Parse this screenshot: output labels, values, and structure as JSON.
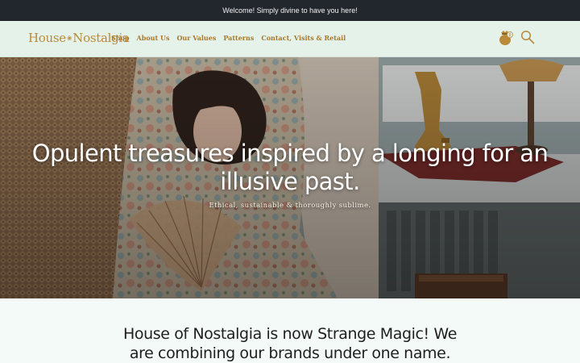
{
  "announcement_bar": {
    "text": "Welcome! Simply divine to have you here!"
  },
  "header": {
    "logo_left": "House",
    "logo_right": "Nostalgia",
    "nav": [
      "Shop",
      "About Us",
      "Our Values",
      "Patterns",
      "Contact, Visits & Retail"
    ],
    "cart_count": "0",
    "icons": [
      "money-bag-icon",
      "search-icon"
    ]
  },
  "hero": {
    "headline": "Opulent treasures inspired by a longing for an illusive past.",
    "subheadline": "Ethical, sustainable & thoroughly sublime."
  },
  "announcement_section": {
    "heading": "House of Nostalgia is now Strange Magic! We are combining our brands under one name."
  },
  "colors": {
    "announcement_bg": "#22262d",
    "header_bg": "#e4f2ea",
    "brand_gold": "#b98a39",
    "nav_text": "#a8792c",
    "page_bg": "#f4faf7"
  }
}
